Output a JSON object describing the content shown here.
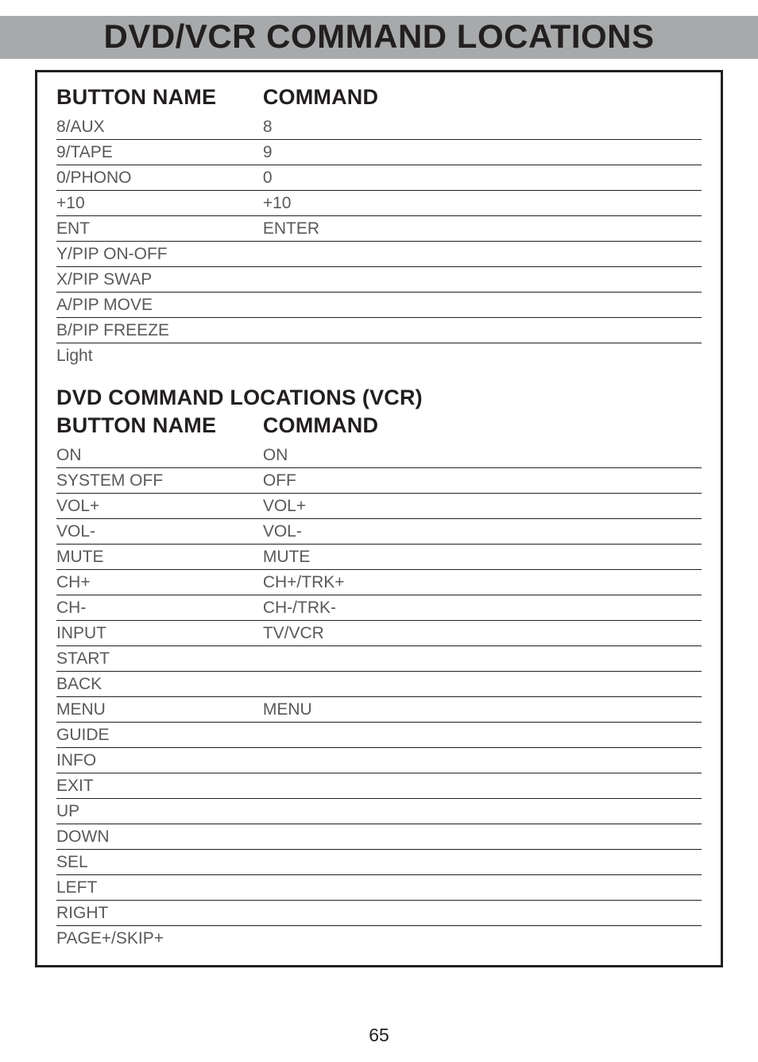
{
  "title": "DVD/VCR COMMAND LOCATIONS",
  "page_number": "65",
  "table1": {
    "header_button": "BUTTON NAME",
    "header_command": "COMMAND",
    "rows": [
      {
        "button": "8/AUX",
        "command": "8"
      },
      {
        "button": "9/TAPE",
        "command": "9"
      },
      {
        "button": "0/PHONO",
        "command": "0"
      },
      {
        "button": "+10",
        "command": "+10"
      },
      {
        "button": "ENT",
        "command": "ENTER"
      },
      {
        "button": "Y/PIP ON-OFF",
        "command": ""
      },
      {
        "button": "X/PIP SWAP",
        "command": ""
      },
      {
        "button": "A/PIP MOVE",
        "command": ""
      },
      {
        "button": "B/PIP FREEZE",
        "command": ""
      },
      {
        "button": "Light",
        "command": ""
      }
    ]
  },
  "section2_title": "DVD COMMAND LOCATIONS (VCR)",
  "table2": {
    "header_button": "BUTTON NAME",
    "header_command": "COMMAND",
    "rows": [
      {
        "button": "ON",
        "command": "ON"
      },
      {
        "button": "SYSTEM OFF",
        "command": "OFF"
      },
      {
        "button": "VOL+",
        "command": "VOL+"
      },
      {
        "button": "VOL-",
        "command": "VOL-"
      },
      {
        "button": "MUTE",
        "command": "MUTE"
      },
      {
        "button": "CH+",
        "command": "CH+/TRK+"
      },
      {
        "button": "CH-",
        "command": "CH-/TRK-"
      },
      {
        "button": "INPUT",
        "command": "TV/VCR"
      },
      {
        "button": "START",
        "command": ""
      },
      {
        "button": "BACK",
        "command": ""
      },
      {
        "button": "MENU",
        "command": "MENU"
      },
      {
        "button": "GUIDE",
        "command": ""
      },
      {
        "button": "INFO",
        "command": ""
      },
      {
        "button": "EXIT",
        "command": ""
      },
      {
        "button": "UP",
        "command": ""
      },
      {
        "button": "DOWN",
        "command": ""
      },
      {
        "button": "SEL",
        "command": ""
      },
      {
        "button": "LEFT",
        "command": ""
      },
      {
        "button": "RIGHT",
        "command": ""
      },
      {
        "button": "PAGE+/SKIP+",
        "command": ""
      }
    ]
  }
}
